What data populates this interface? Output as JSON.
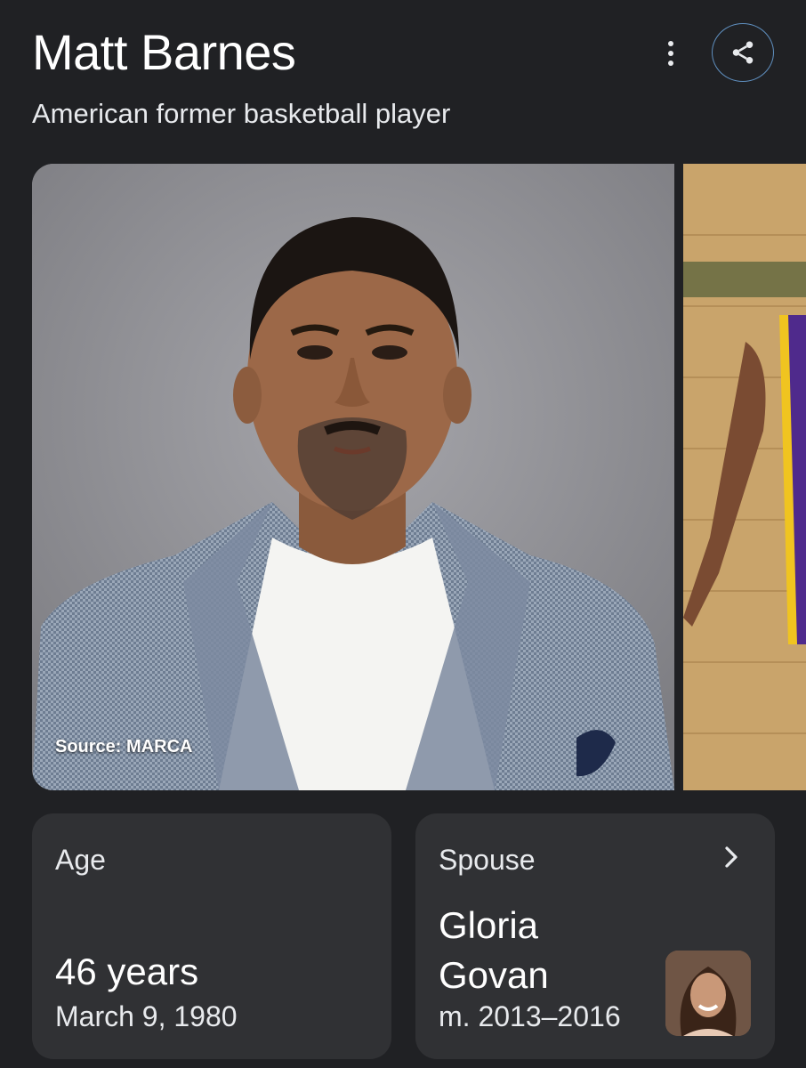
{
  "entity": {
    "name": "Matt Barnes",
    "description": "American former basketball player"
  },
  "header": {
    "more_icon": "more-vert-icon",
    "share_icon": "share-icon"
  },
  "images": {
    "main_source": "Source: MARCA"
  },
  "facts": {
    "age": {
      "label": "Age",
      "value": "46 years",
      "sub": "March 9, 1980"
    },
    "spouse": {
      "label": "Spouse",
      "name": "Gloria Govan",
      "sub": "m. 2013–2016",
      "chevron_icon": "chevron-right-icon"
    }
  },
  "colors": {
    "background": "#202124",
    "card": "#303134",
    "share_ring": "#5f8fbf"
  }
}
